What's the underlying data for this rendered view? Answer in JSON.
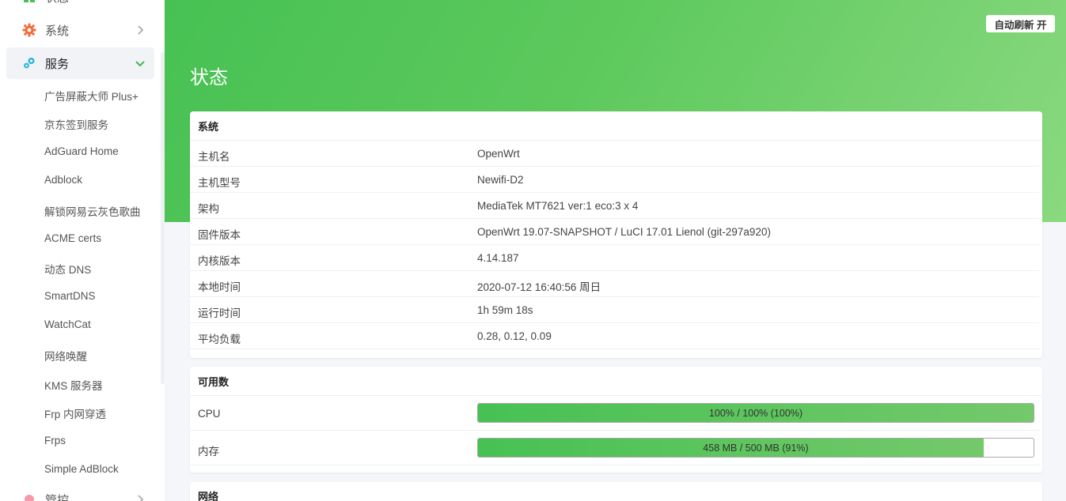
{
  "sidebar": {
    "top_partial_label": "状态",
    "menus": [
      {
        "label": "系统",
        "icon": "gear-icon"
      },
      {
        "label": "服务",
        "icon": "services-icon"
      }
    ],
    "bottom_partial_label": "管控",
    "service_items": [
      "广告屏蔽大师 Plus+",
      "京东签到服务",
      "AdGuard Home",
      "Adblock",
      "解锁网易云灰色歌曲",
      "ACME certs",
      "动态 DNS",
      "SmartDNS",
      "WatchCat",
      "网络唤醒",
      "KMS 服务器",
      "Frp 内网穿透",
      "Frps",
      "Simple AdBlock"
    ]
  },
  "header": {
    "auto_refresh": "自动刷新 开",
    "title": "状态"
  },
  "system": {
    "title": "系统",
    "rows": [
      {
        "key": "主机名",
        "value": "OpenWrt"
      },
      {
        "key": "主机型号",
        "value": "Newifi-D2"
      },
      {
        "key": "架构",
        "value": "MediaTek MT7621 ver:1 eco:3 x 4"
      },
      {
        "key": "固件版本",
        "value": "OpenWrt 19.07-SNAPSHOT / LuCI 17.01 Lienol (git-297a920)"
      },
      {
        "key": "内核版本",
        "value": "4.14.187"
      },
      {
        "key": "本地时间",
        "value": "2020-07-12 16:40:56 周日"
      },
      {
        "key": "运行时间",
        "value": "1h 59m 18s"
      },
      {
        "key": "平均负载",
        "value": "0.28, 0.12, 0.09"
      }
    ]
  },
  "available": {
    "title": "可用数",
    "rows": [
      {
        "key": "CPU",
        "text": "100% / 100% (100%)",
        "fraction": 1.0
      },
      {
        "key": "内存",
        "text": "458 MB / 500 MB (91%)",
        "fraction": 0.91
      }
    ]
  },
  "network": {
    "title": "网络"
  },
  "colors": {
    "accent": "#47c153",
    "accent_light": "#8ad97f",
    "gear_icon": "#f26b3a",
    "services_icon": "#27b4d6",
    "active_arrow": "#3fba4f"
  }
}
